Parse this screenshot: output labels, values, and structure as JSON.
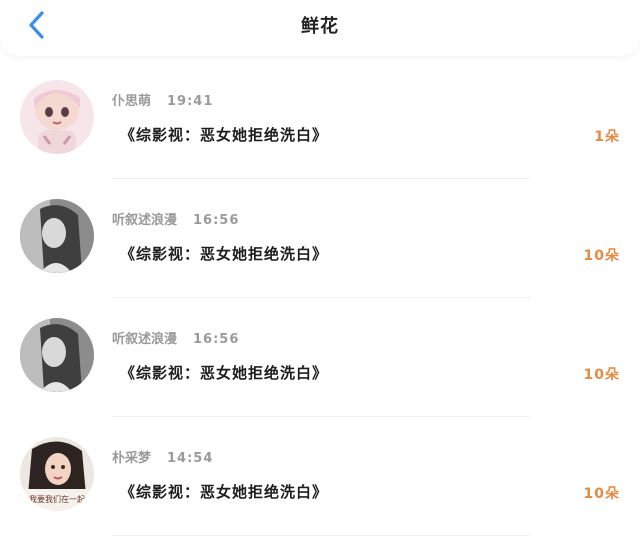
{
  "header": {
    "title": "鲜花",
    "back_icon": "chevron-left-icon"
  },
  "colors": {
    "accent_back": "#3a8ee6",
    "count": "#e48a43",
    "meta": "#9a9a9a"
  },
  "items": [
    {
      "user": "仆思萌",
      "time": "19:41",
      "book": "《综影视：恶女她拒绝洗白》",
      "count": "1朵",
      "avatar": "avatar-cartoon-girl"
    },
    {
      "user": "听叙述浪漫",
      "time": "16:56",
      "book": "《综影视：恶女她拒绝洗白》",
      "count": "10朵",
      "avatar": "avatar-bw-girl"
    },
    {
      "user": "听叙述浪漫",
      "time": "16:56",
      "book": "《综影视：恶女她拒绝洗白》",
      "count": "10朵",
      "avatar": "avatar-bw-girl"
    },
    {
      "user": "朴采梦",
      "time": "14:54",
      "book": "《综影视：恶女她拒绝洗白》",
      "count": "10朵",
      "avatar": "avatar-photo-girl",
      "avatar_caption": "我要我们在一起"
    }
  ]
}
